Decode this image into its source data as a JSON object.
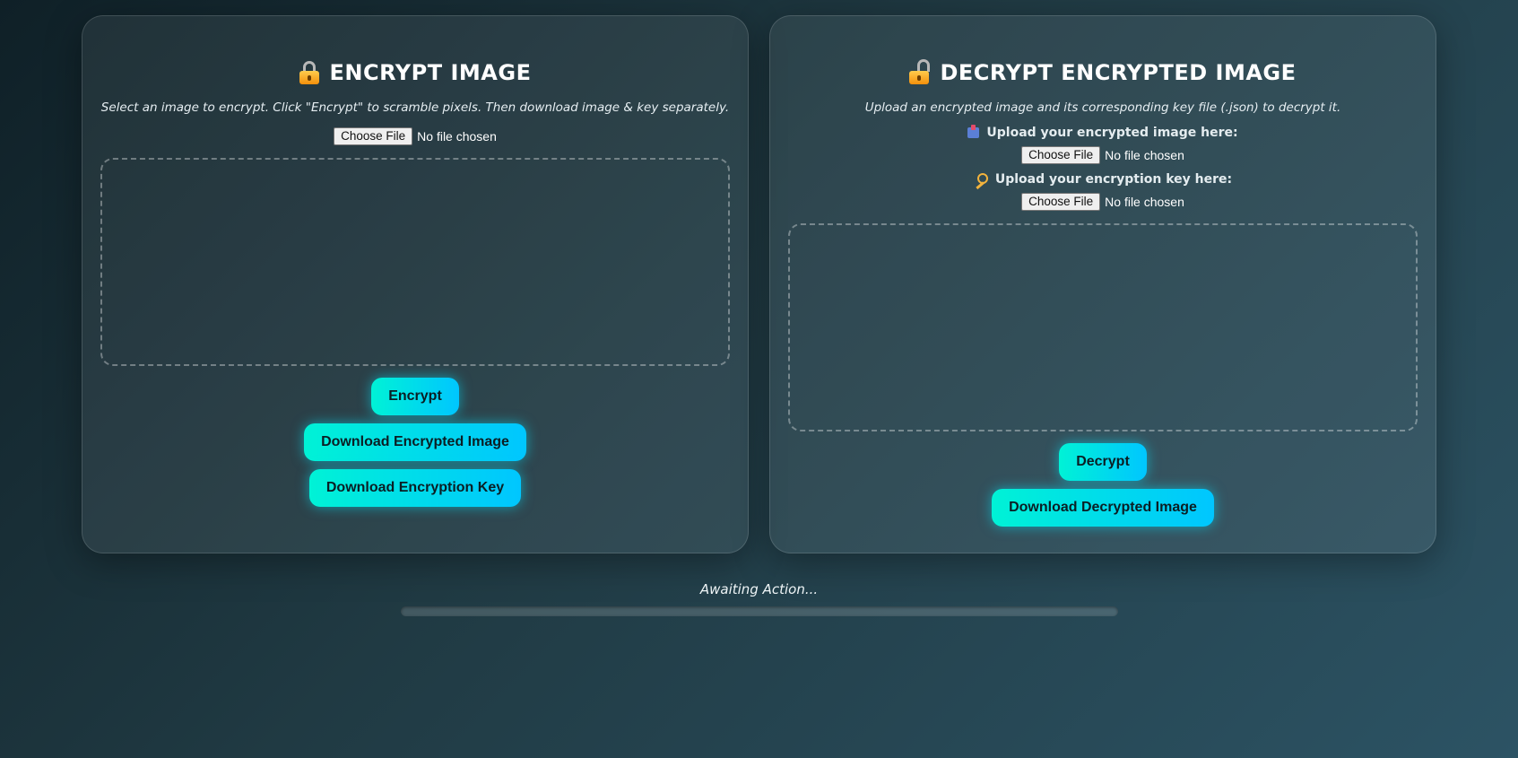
{
  "encrypt": {
    "title": "ENCRYPT IMAGE",
    "subtitle": "Select an image to encrypt. Click \"Encrypt\" to scramble pixels. Then download image & key separately.",
    "file_button": "Choose File",
    "file_status": "No file chosen",
    "encrypt_button": "Encrypt",
    "download_image_button": "Download Encrypted Image",
    "download_key_button": "Download Encryption Key"
  },
  "decrypt": {
    "title": "DECRYPT ENCRYPTED IMAGE",
    "subtitle": "Upload an encrypted image and its corresponding key file (.json) to decrypt it.",
    "image_label": "Upload your encrypted image here:",
    "image_file_button": "Choose File",
    "image_file_status": "No file chosen",
    "key_label": "Upload your encryption key here:",
    "key_file_button": "Choose File",
    "key_file_status": "No file chosen",
    "decrypt_button": "Decrypt",
    "download_button": "Download Decrypted Image"
  },
  "status": {
    "text": "Awaiting Action...",
    "progress": 0
  },
  "icons": {
    "encrypt_title": "locked-padlock-icon",
    "decrypt_title": "unlocked-padlock-icon",
    "image_upload": "inbox-tray-icon",
    "key_upload": "key-icon"
  },
  "colors": {
    "accent_start": "#00f2d6",
    "accent_end": "#00c6ff"
  }
}
